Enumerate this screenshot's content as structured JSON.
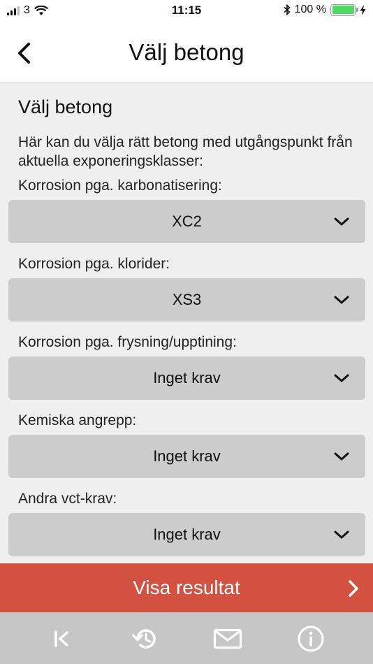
{
  "status_bar": {
    "carrier": "3",
    "time": "11:15",
    "battery_text": "100 %"
  },
  "nav": {
    "title": "Välj betong",
    "back_icon": "chevron-left-icon"
  },
  "section": {
    "title": "Välj betong",
    "intro": "Här kan du välja rätt betong med utgångspunkt från aktuella exponeringsklasser:"
  },
  "fields": [
    {
      "label": "Korrosion pga. karbonatisering:",
      "value": "XC2"
    },
    {
      "label": "Korrosion pga. klorider:",
      "value": "XS3"
    },
    {
      "label": "Korrosion pga. frysning/upptining:",
      "value": "Inget krav"
    },
    {
      "label": "Kemiska angrepp:",
      "value": "Inget krav"
    },
    {
      "label": "Andra vct-krav:",
      "value": "Inget krav"
    }
  ],
  "result_button": {
    "label": "Visa resultat"
  },
  "tab_bar": {
    "icons": [
      "first-page-icon",
      "history-icon",
      "mail-icon",
      "info-icon"
    ]
  },
  "colors": {
    "accent": "#d35141",
    "dropdown_bg": "#cccccc",
    "content_bg": "#efefef",
    "tab_bar_bg": "#c6c6c6",
    "battery": "#4cd964"
  }
}
